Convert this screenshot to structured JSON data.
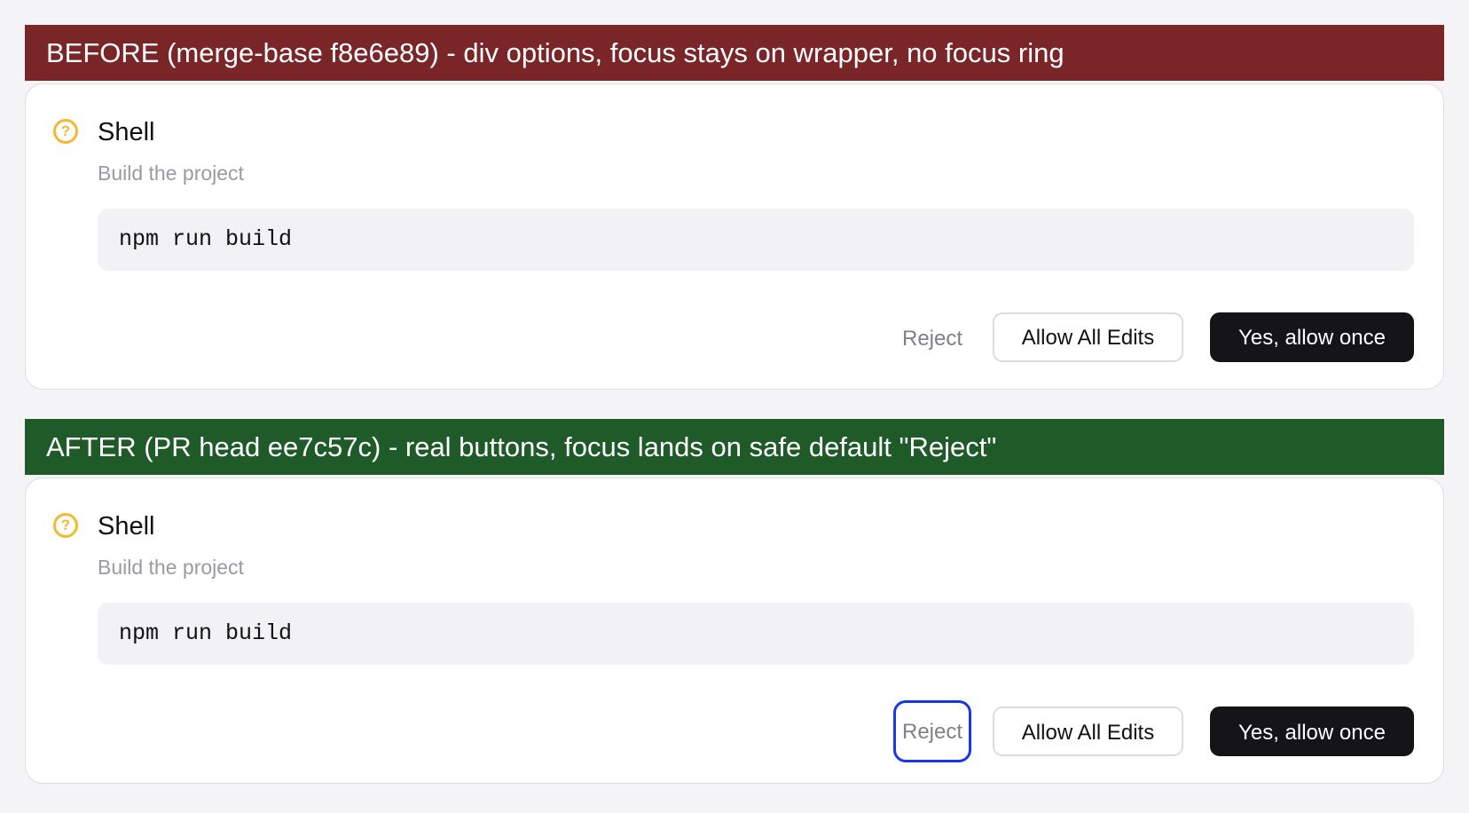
{
  "before": {
    "banner": "BEFORE (merge-base f8e6e89) - div options, focus stays on wrapper, no focus ring",
    "card": {
      "icon": "?",
      "title": "Shell",
      "subtitle": "Build the project",
      "command": "npm run build",
      "buttons": {
        "reject": "Reject",
        "allow_all": "Allow All Edits",
        "allow_once": "Yes, allow once"
      }
    }
  },
  "after": {
    "banner": "AFTER (PR head ee7c57c) - real buttons, focus lands on safe default \"Reject\"",
    "card": {
      "icon": "?",
      "title": "Shell",
      "subtitle": "Build the project",
      "command": "npm run build",
      "buttons": {
        "reject": "Reject",
        "allow_all": "Allow All Edits",
        "allow_once": "Yes, allow once"
      }
    }
  },
  "colors": {
    "before_banner": "#7a2629",
    "after_banner": "#1f5b29",
    "question_icon": "#f5b82e",
    "focus_ring": "#1638e6",
    "primary_button": "#151517"
  }
}
